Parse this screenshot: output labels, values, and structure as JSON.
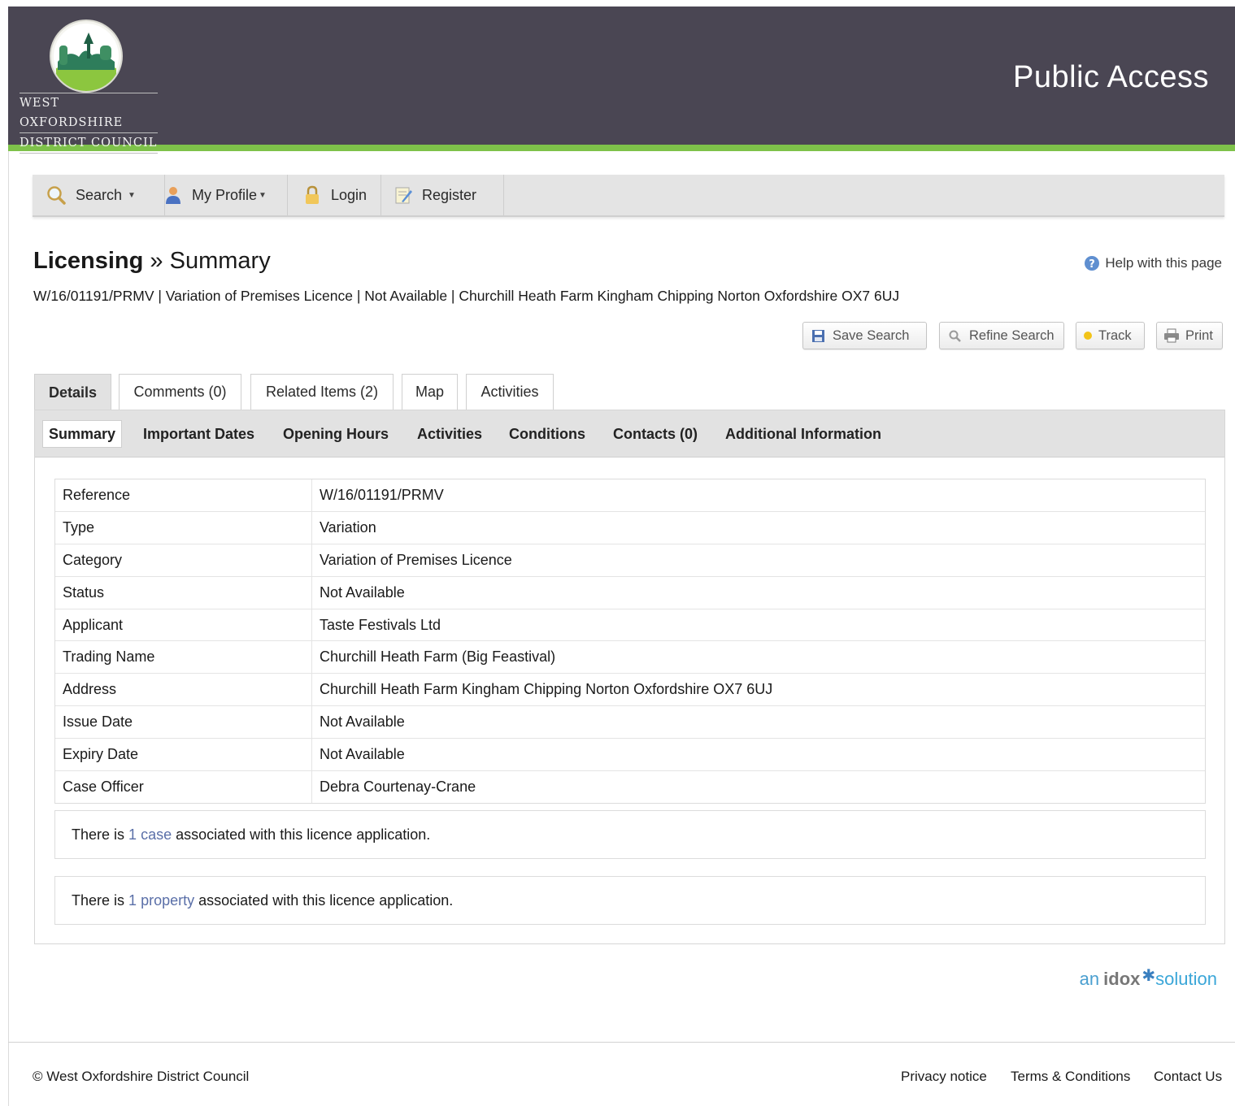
{
  "header": {
    "council_line1": "WEST OXFORDSHIRE",
    "council_line2": "DISTRICT COUNCIL",
    "portal_title": "Public Access"
  },
  "nav": {
    "search": "Search",
    "my_profile": "My Profile",
    "login": "Login",
    "register": "Register"
  },
  "page": {
    "section": "Licensing",
    "separator": "»",
    "subsection": "Summary",
    "help": "Help with this page",
    "case_line": "W/16/01191/PRMV | Variation of Premises Licence | Not Available | Churchill Heath Farm Kingham Chipping Norton Oxfordshire OX7 6UJ"
  },
  "actions": {
    "save_search": "Save Search",
    "refine_search": "Refine Search",
    "track": "Track",
    "print": "Print"
  },
  "tabs": [
    {
      "label": "Details",
      "active": true
    },
    {
      "label": "Comments (0)"
    },
    {
      "label": "Related Items (2)"
    },
    {
      "label": "Map"
    },
    {
      "label": "Activities"
    }
  ],
  "subtabs": [
    {
      "label": "Summary",
      "active": true
    },
    {
      "label": "Important Dates"
    },
    {
      "label": "Opening Hours"
    },
    {
      "label": "Activities"
    },
    {
      "label": "Conditions"
    },
    {
      "label": "Contacts (0)"
    },
    {
      "label": "Additional Information"
    }
  ],
  "details": [
    {
      "label": "Reference",
      "value": "W/16/01191/PRMV"
    },
    {
      "label": "Type",
      "value": "Variation"
    },
    {
      "label": "Category",
      "value": "Variation of Premises Licence"
    },
    {
      "label": "Status",
      "value": "Not Available"
    },
    {
      "label": "Applicant",
      "value": "Taste Festivals Ltd"
    },
    {
      "label": "Trading Name",
      "value": "Churchill Heath Farm (Big Feastival)"
    },
    {
      "label": "Address",
      "value": "Churchill Heath Farm Kingham Chipping Norton Oxfordshire OX7 6UJ"
    },
    {
      "label": "Issue Date",
      "value": "Not Available"
    },
    {
      "label": "Expiry Date",
      "value": "Not Available"
    },
    {
      "label": "Case Officer",
      "value": "Debra Courtenay-Crane"
    }
  ],
  "associations": {
    "case": {
      "prefix": "There is",
      "count": "1",
      "link": "case",
      "suffix": "associated with this licence application."
    },
    "property": {
      "prefix": "There is",
      "count": "1",
      "link": "property",
      "suffix": "associated with this licence application."
    }
  },
  "branding": {
    "an": "an",
    "idox": "idox",
    "solution": "solution"
  },
  "footer": {
    "copyright": "© West Oxfordshire District Council",
    "privacy": "Privacy notice",
    "terms": "Terms & Conditions",
    "contact": "Contact Us"
  },
  "colors": {
    "header_bg": "#4a4653",
    "accent_green": "#7ec24a",
    "link_blue": "#5a6fa8"
  }
}
